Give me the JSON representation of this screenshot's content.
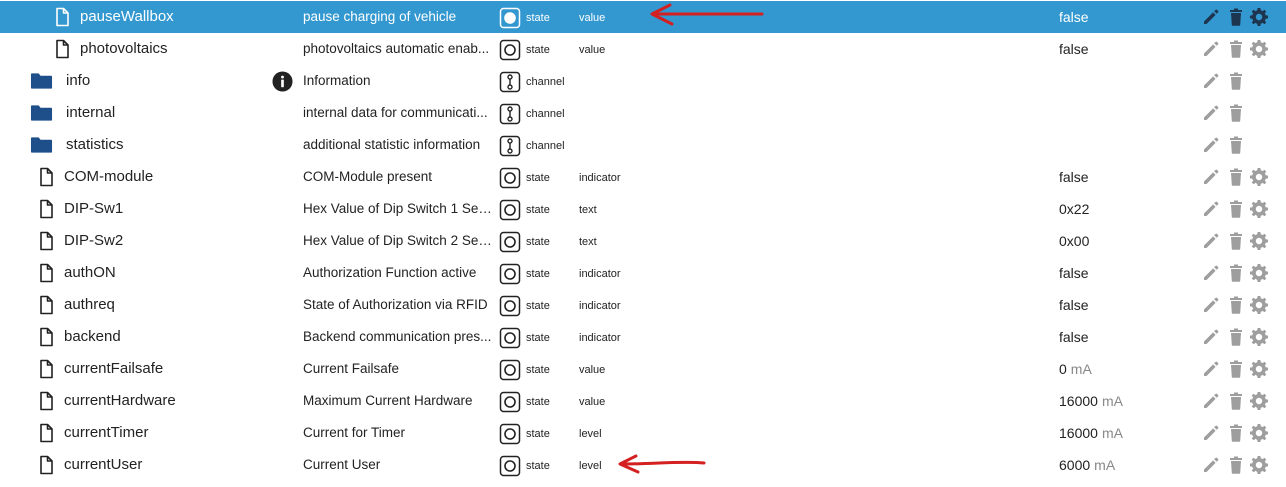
{
  "rows": [
    {
      "name": "pauseWallbox",
      "kind": "file",
      "indent": 2,
      "desc": "pause charging of vehicle",
      "type": "state",
      "role": "value",
      "value": "false",
      "unit": "",
      "selected": true,
      "actions": [
        "edit",
        "delete",
        "settings"
      ],
      "state_icon": "state-active-icon"
    },
    {
      "name": "photovoltaics",
      "kind": "file",
      "indent": 2,
      "desc": "photovoltaics automatic enab...",
      "type": "state",
      "role": "value",
      "value": "false",
      "unit": "",
      "selected": false,
      "actions": [
        "edit",
        "delete",
        "settings"
      ],
      "state_icon": "state-icon"
    },
    {
      "name": "info",
      "kind": "folder",
      "indent": 1,
      "desc": "Information",
      "type": "channel",
      "role": "",
      "value": "",
      "unit": "",
      "selected": false,
      "actions": [
        "edit",
        "delete"
      ],
      "info_badge": true
    },
    {
      "name": "internal",
      "kind": "folder",
      "indent": 1,
      "desc": "internal data for communicati...",
      "type": "channel",
      "role": "",
      "value": "",
      "unit": "",
      "selected": false,
      "actions": [
        "edit",
        "delete"
      ]
    },
    {
      "name": "statistics",
      "kind": "folder",
      "indent": 1,
      "desc": "additional statistic information",
      "type": "channel",
      "role": "",
      "value": "",
      "unit": "",
      "selected": false,
      "actions": [
        "edit",
        "delete"
      ]
    },
    {
      "name": "COM-module",
      "kind": "file",
      "indent": 1,
      "desc": "COM-Module present",
      "type": "state",
      "role": "indicator",
      "value": "false",
      "unit": "",
      "selected": false,
      "actions": [
        "edit",
        "delete",
        "settings"
      ]
    },
    {
      "name": "DIP-Sw1",
      "kind": "file",
      "indent": 1,
      "desc": "Hex Value of Dip Switch 1 Set...",
      "type": "state",
      "role": "text",
      "value": "0x22",
      "unit": "",
      "selected": false,
      "actions": [
        "edit",
        "delete",
        "settings"
      ]
    },
    {
      "name": "DIP-Sw2",
      "kind": "file",
      "indent": 1,
      "desc": "Hex Value of Dip Switch 2 Set...",
      "type": "state",
      "role": "text",
      "value": "0x00",
      "unit": "",
      "selected": false,
      "actions": [
        "edit",
        "delete",
        "settings"
      ]
    },
    {
      "name": "authON",
      "kind": "file",
      "indent": 1,
      "desc": "Authorization Function active",
      "type": "state",
      "role": "indicator",
      "value": "false",
      "unit": "",
      "selected": false,
      "actions": [
        "edit",
        "delete",
        "settings"
      ]
    },
    {
      "name": "authreq",
      "kind": "file",
      "indent": 1,
      "desc": "State of Authorization via RFID",
      "type": "state",
      "role": "indicator",
      "value": "false",
      "unit": "",
      "selected": false,
      "actions": [
        "edit",
        "delete",
        "settings"
      ]
    },
    {
      "name": "backend",
      "kind": "file",
      "indent": 1,
      "desc": "Backend communication pres...",
      "type": "state",
      "role": "indicator",
      "value": "false",
      "unit": "",
      "selected": false,
      "actions": [
        "edit",
        "delete",
        "settings"
      ]
    },
    {
      "name": "currentFailsafe",
      "kind": "file",
      "indent": 1,
      "desc": "Current Failsafe",
      "type": "state",
      "role": "value",
      "value": "0",
      "unit": "mA",
      "selected": false,
      "actions": [
        "edit",
        "delete",
        "settings"
      ]
    },
    {
      "name": "currentHardware",
      "kind": "file",
      "indent": 1,
      "desc": "Maximum Current Hardware",
      "type": "state",
      "role": "value",
      "value": "16000",
      "unit": "mA",
      "selected": false,
      "actions": [
        "edit",
        "delete",
        "settings"
      ]
    },
    {
      "name": "currentTimer",
      "kind": "file",
      "indent": 1,
      "desc": "Current for Timer",
      "type": "state",
      "role": "level",
      "value": "16000",
      "unit": "mA",
      "selected": false,
      "actions": [
        "edit",
        "delete",
        "settings"
      ]
    },
    {
      "name": "currentUser",
      "kind": "file",
      "indent": 1,
      "desc": "Current User",
      "type": "state",
      "role": "level",
      "value": "6000",
      "unit": "mA",
      "selected": false,
      "actions": [
        "edit",
        "delete",
        "settings"
      ]
    }
  ],
  "colors": {
    "selected_bg": "#3398d0",
    "folder": "#1f4f8a",
    "icon_gray": "#9e9e9e",
    "annotation_arrow": "#d42020"
  },
  "annotations": [
    {
      "icon": "red-arrow-annotation",
      "points_to": "pauseWallbox"
    },
    {
      "icon": "red-arrow-annotation",
      "points_to": "currentUser"
    }
  ]
}
